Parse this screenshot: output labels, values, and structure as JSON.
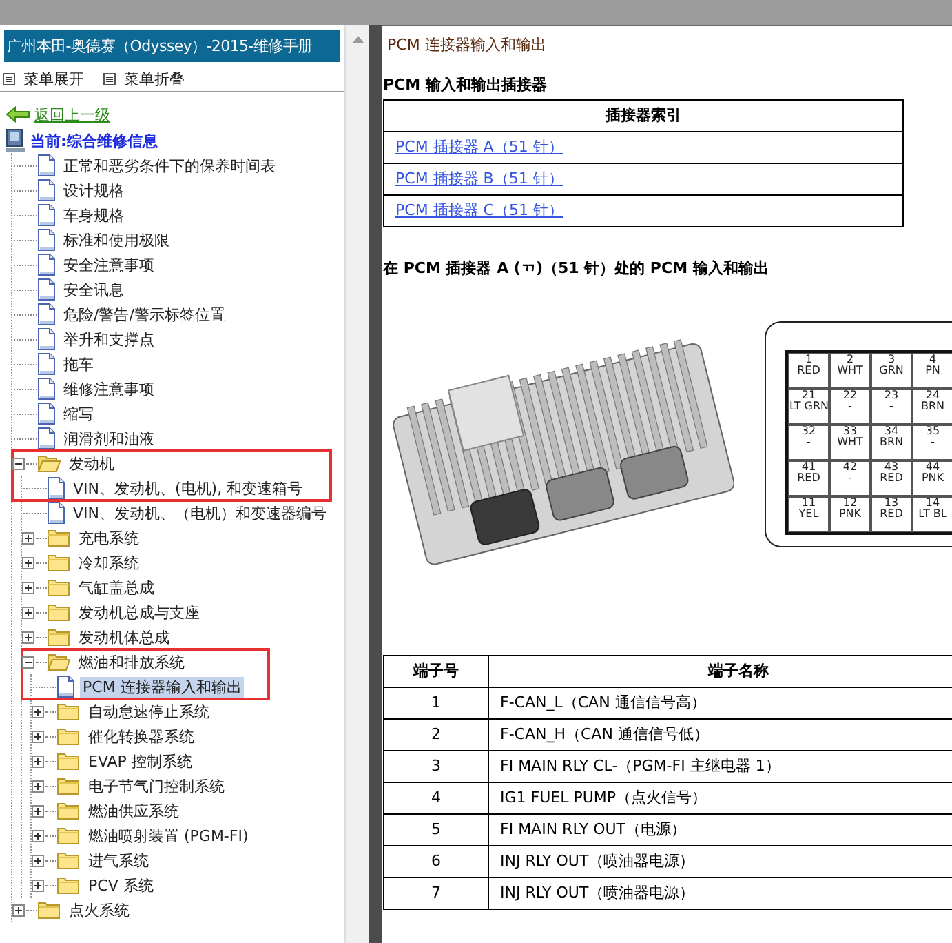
{
  "sidebar": {
    "title": "广州本田-奥德赛（Odyssey）-2015-维修手册",
    "menu_buttons": [
      {
        "label": "菜单展开"
      },
      {
        "label": "菜单折叠"
      }
    ],
    "back_link": "返回上一级",
    "tree": {
      "label": "当前:综合维修信息",
      "kind": "computer",
      "selected": false,
      "children": [
        {
          "label": "正常和恶劣条件下的保养时间表",
          "kind": "doc",
          "selected": false
        },
        {
          "label": "设计规格",
          "kind": "doc",
          "selected": false
        },
        {
          "label": "车身规格",
          "kind": "doc",
          "selected": false
        },
        {
          "label": "标准和使用极限",
          "kind": "doc",
          "selected": false
        },
        {
          "label": "安全注意事项",
          "kind": "doc",
          "selected": false
        },
        {
          "label": "安全讯息",
          "kind": "doc",
          "selected": false
        },
        {
          "label": "危险/警告/警示标签位置",
          "kind": "doc",
          "selected": false
        },
        {
          "label": "举升和支撑点",
          "kind": "doc",
          "selected": false
        },
        {
          "label": "拖车",
          "kind": "doc",
          "selected": false
        },
        {
          "label": "维修注意事项",
          "kind": "doc",
          "selected": false
        },
        {
          "label": "缩写",
          "kind": "doc",
          "selected": false
        },
        {
          "label": "润滑剂和油液",
          "kind": "doc",
          "selected": false
        },
        {
          "label": "发动机",
          "kind": "folder",
          "expanded": true,
          "selected": false,
          "annotated": true,
          "children": [
            {
              "label": "VIN、发动机、(电机), 和变速箱号",
              "kind": "doc",
              "selected": false
            },
            {
              "label": "VIN、发动机、（电机）和变速器编号",
              "kind": "doc",
              "selected": false
            },
            {
              "label": "充电系统",
              "kind": "folder",
              "expanded": false,
              "selected": false
            },
            {
              "label": "冷却系统",
              "kind": "folder",
              "expanded": false,
              "selected": false
            },
            {
              "label": "气缸盖总成",
              "kind": "folder",
              "expanded": false,
              "selected": false
            },
            {
              "label": "发动机总成与支座",
              "kind": "folder",
              "expanded": false,
              "selected": false
            },
            {
              "label": "发动机体总成",
              "kind": "folder",
              "expanded": false,
              "selected": false
            },
            {
              "label": "燃油和排放系统",
              "kind": "folder",
              "expanded": true,
              "selected": false,
              "annotated": true,
              "children": [
                {
                  "label": "PCM 连接器输入和输出",
                  "kind": "doc",
                  "selected": true
                },
                {
                  "label": "自动怠速停止系统",
                  "kind": "folder",
                  "expanded": false,
                  "selected": false
                },
                {
                  "label": "催化转换器系统",
                  "kind": "folder",
                  "expanded": false,
                  "selected": false
                },
                {
                  "label": "EVAP 控制系统",
                  "kind": "folder",
                  "expanded": false,
                  "selected": false
                },
                {
                  "label": "电子节气门控制系统",
                  "kind": "folder",
                  "expanded": false,
                  "selected": false
                },
                {
                  "label": "燃油供应系统",
                  "kind": "folder",
                  "expanded": false,
                  "selected": false
                },
                {
                  "label": "燃油喷射装置 (PGM-FI)",
                  "kind": "folder",
                  "expanded": false,
                  "selected": false
                },
                {
                  "label": "进气系统",
                  "kind": "folder",
                  "expanded": false,
                  "selected": false
                },
                {
                  "label": "PCV 系统",
                  "kind": "folder",
                  "expanded": false,
                  "selected": false
                }
              ]
            }
          ]
        },
        {
          "label": "点火系统",
          "kind": "folder",
          "expanded": false,
          "selected": false
        }
      ]
    }
  },
  "content": {
    "title": "PCM 连接器输入和输出",
    "index_heading": "PCM 输入和输出插接器",
    "index_table": {
      "header": "插接器索引",
      "links": [
        "PCM 插接器 A（51 针）",
        "PCM 插接器 B（51 针）",
        "PCM 插接器 C（51 针）"
      ]
    },
    "section_heading": "在 PCM 插接器 A (ᆩ)（51 针）处的 PCM 输入和输出",
    "pinout": [
      [
        {
          "num": "1",
          "wire": "RED"
        },
        {
          "num": "2",
          "wire": "WHT"
        },
        {
          "num": "3",
          "wire": "GRN"
        },
        {
          "num": "4",
          "wire": "PN"
        }
      ],
      [
        {
          "num": "21",
          "wire": "LT GRN"
        },
        {
          "num": "22",
          "wire": "-"
        },
        {
          "num": "23",
          "wire": "-"
        },
        {
          "num": "24",
          "wire": "BRN"
        }
      ],
      [
        {
          "num": "32",
          "wire": "-"
        },
        {
          "num": "33",
          "wire": "WHT"
        },
        {
          "num": "34",
          "wire": "BRN"
        },
        {
          "num": "35",
          "wire": "-"
        }
      ],
      [
        {
          "num": "41",
          "wire": "RED"
        },
        {
          "num": "42",
          "wire": "-"
        },
        {
          "num": "43",
          "wire": "RED"
        },
        {
          "num": "44",
          "wire": "PNK"
        }
      ],
      [
        {
          "num": "11",
          "wire": "YEL"
        },
        {
          "num": "12",
          "wire": "PNK"
        },
        {
          "num": "13",
          "wire": "RED"
        },
        {
          "num": "14",
          "wire": "LT BL"
        }
      ]
    ],
    "terminal_table": {
      "columns": [
        "端子号",
        "端子名称"
      ],
      "rows": [
        [
          "1",
          "F-CAN_L（CAN 通信信号高）"
        ],
        [
          "2",
          "F-CAN_H（CAN 通信信号低）"
        ],
        [
          "3",
          "FI MAIN RLY CL-（PGM-FI 主继电器 1）"
        ],
        [
          "4",
          "IG1 FUEL PUMP（点火信号）"
        ],
        [
          "5",
          "FI MAIN RLY OUT（电源）"
        ],
        [
          "6",
          "INJ RLY OUT（喷油器电源）"
        ],
        [
          "7",
          "INJ RLY OUT（喷油器电源）"
        ]
      ]
    }
  }
}
